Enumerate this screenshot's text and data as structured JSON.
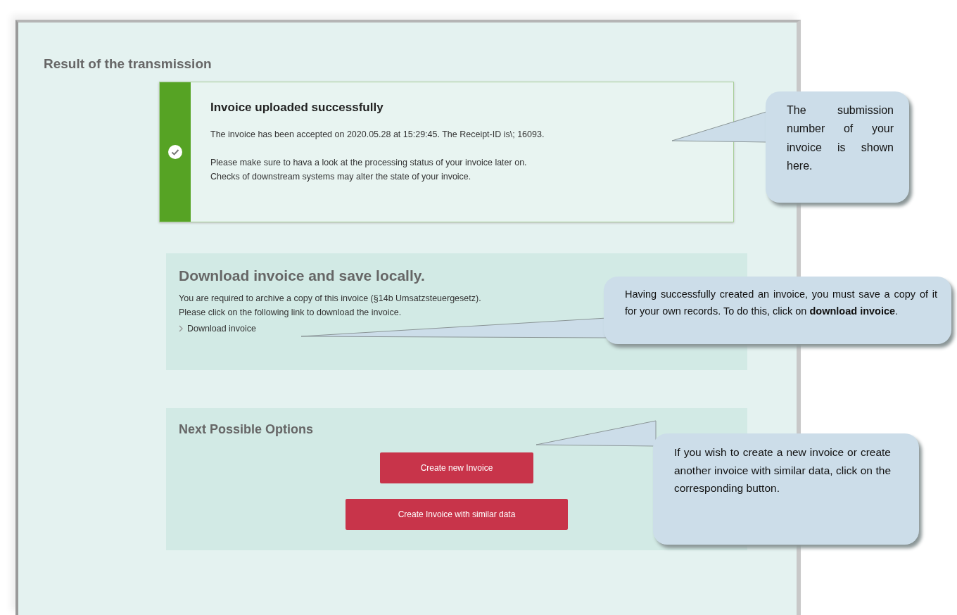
{
  "page": {
    "title": "Result of the transmission"
  },
  "status_card": {
    "succeeded": true,
    "title": "Invoice uploaded successfully",
    "paragraphs": [
      "The invoice has been accepted on 2020.05.28 at 15:29:45. The Receipt-ID is\\; 16093.",
      "Please make sure to hava a look at the processing status of your invoice later on.",
      "Checks of downstream systems may alter the state of your invoice."
    ]
  },
  "download_section": {
    "title": "Download invoice and save locally.",
    "paragraphs": [
      "You are required to archive a copy of this invoice (§14b Umsatzsteuergesetz).",
      "Please click on the following link to download the invoice."
    ],
    "link": "Download invoice"
  },
  "options_section": {
    "title": "Next Possible Options",
    "buttons": [
      "Create new Invoice",
      "Create Invoice with similar data"
    ]
  },
  "callouts": [
    {
      "text": "The submission number of your invoice is shown here."
    },
    {
      "text": "Having successfully created an invoice, you must save a copy of it for your own records. To do this, click on **download invoice**."
    },
    {
      "text": "If you wish to create a new invoice or create another invoice with similar data, click on the corresponding button."
    }
  ]
}
